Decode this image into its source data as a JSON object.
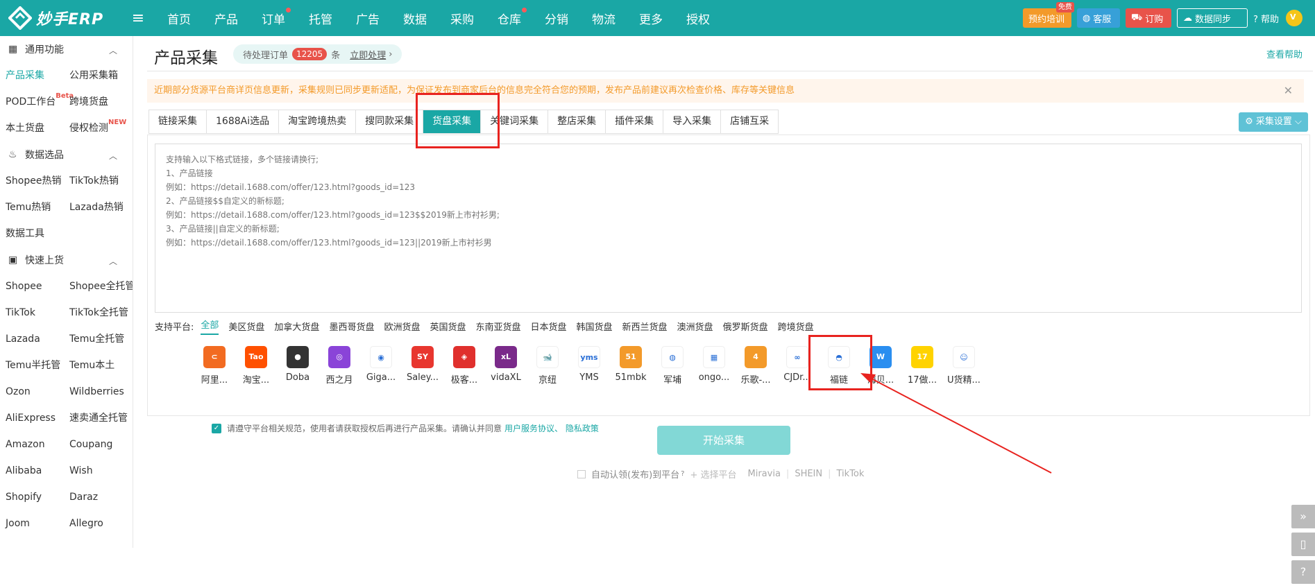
{
  "app": {
    "logo_text": "妙手ERP"
  },
  "nav": {
    "items": [
      {
        "label": "首页",
        "dot": false
      },
      {
        "label": "产品",
        "dot": false
      },
      {
        "label": "订单",
        "dot": true
      },
      {
        "label": "托管",
        "dot": false
      },
      {
        "label": "广告",
        "dot": false
      },
      {
        "label": "数据",
        "dot": false
      },
      {
        "label": "采购",
        "dot": false
      },
      {
        "label": "仓库",
        "dot": true
      },
      {
        "label": "分销",
        "dot": false
      },
      {
        "label": "物流",
        "dot": false
      },
      {
        "label": "更多",
        "dot": false
      },
      {
        "label": "授权",
        "dot": false
      }
    ]
  },
  "topbar": {
    "training": "预约培训",
    "training_badge": "免费",
    "service": "客服",
    "subscribe": "订购",
    "sync": "数据同步",
    "help": "帮助",
    "avatar_letter": "V"
  },
  "sidebar": {
    "sections": [
      {
        "title": "通用功能",
        "items": [
          {
            "label": "产品采集",
            "active": true
          },
          {
            "label": "公用采集箱"
          },
          {
            "label": "POD工作台",
            "sup": "Beta"
          },
          {
            "label": "跨境货盘"
          },
          {
            "label": "本土货盘"
          },
          {
            "label": "侵权检测",
            "sup": "NEW"
          }
        ]
      },
      {
        "title": "数据选品",
        "items": [
          {
            "label": "Shopee热销"
          },
          {
            "label": "TikTok热销"
          },
          {
            "label": "Temu热销"
          },
          {
            "label": "Lazada热销"
          },
          {
            "label": "数据工具"
          }
        ]
      },
      {
        "title": "快速上货",
        "items": [
          {
            "label": "Shopee"
          },
          {
            "label": "Shopee全托管"
          },
          {
            "label": "TikTok"
          },
          {
            "label": "TikTok全托管"
          },
          {
            "label": "Lazada"
          },
          {
            "label": "Temu全托管"
          },
          {
            "label": "Temu半托管"
          },
          {
            "label": "Temu本土"
          },
          {
            "label": "Ozon"
          },
          {
            "label": "Wildberries"
          },
          {
            "label": "AliExpress"
          },
          {
            "label": "速卖通全托管"
          },
          {
            "label": "Amazon"
          },
          {
            "label": "Coupang"
          },
          {
            "label": "Alibaba"
          },
          {
            "label": "Wish"
          },
          {
            "label": "Shopify"
          },
          {
            "label": "Daraz"
          },
          {
            "label": "Joom"
          },
          {
            "label": "Allegro"
          }
        ]
      }
    ]
  },
  "main": {
    "title": "产品采集",
    "pending": {
      "label": "待处理订单",
      "count": "12205",
      "unit": "条",
      "link": "立即处理"
    },
    "view_help": "查看帮助",
    "notice": "近期部分货源平台商详页信息更新，采集规则已同步更新适配，为保证发布到商家后台的信息完全符合您的预期，发布产品前建议再次检查价格、库存等关键信息",
    "tabs": [
      "链接采集",
      "1688Ai选品",
      "淘宝跨境热卖",
      "搜同款采集",
      "货盘采集",
      "关键词采集",
      "整店采集",
      "插件采集",
      "导入采集",
      "店铺互采"
    ],
    "active_tab": 4,
    "settings_btn": "采集设置",
    "placeholder": "支持输入以下格式链接，多个链接请换行;\n1、产品链接\n例如：https://detail.1688.com/offer/123.html?goods_id=123\n2、产品链接$$自定义的新标题;\n例如：https://detail.1688.com/offer/123.html?goods_id=123$$2019新上市衬衫男;\n3、产品链接||自定义的新标题;\n例如：https://detail.1688.com/offer/123.html?goods_id=123||2019新上市衬衫男",
    "platform_label": "支持平台:",
    "regions": [
      "全部",
      "美区货盘",
      "加拿大货盘",
      "墨西哥货盘",
      "欧洲货盘",
      "英国货盘",
      "东南亚货盘",
      "日本货盘",
      "韩国货盘",
      "新西兰货盘",
      "澳洲货盘",
      "俄罗斯货盘",
      "跨境货盘"
    ],
    "platforms": [
      {
        "name": "阿里...",
        "logo": "ali",
        "color": "#f26b21",
        "text": "⊂"
      },
      {
        "name": "淘宝...",
        "logo": "tao",
        "color": "#ff5000",
        "text": "Tao"
      },
      {
        "name": "Doba",
        "logo": "doba",
        "color": "#333333",
        "text": "●"
      },
      {
        "name": "西之月",
        "logo": "xzy",
        "color": "#8a44d8",
        "text": "◎"
      },
      {
        "name": "Giga...",
        "logo": "giga",
        "color": "#ffffff",
        "text": "◉"
      },
      {
        "name": "Saley...",
        "logo": "saley",
        "color": "#e8362f",
        "text": "SY"
      },
      {
        "name": "极客...",
        "logo": "jike",
        "color": "#e0302d",
        "text": "◈"
      },
      {
        "name": "vidaXL",
        "logo": "vida",
        "color": "#7a2a8a",
        "text": "xL"
      },
      {
        "name": "京纽",
        "logo": "jn",
        "color": "#ffffff",
        "text": "🐋"
      },
      {
        "name": "YMS",
        "logo": "yms",
        "color": "#ffffff",
        "text": "yms"
      },
      {
        "name": "51mbk",
        "logo": "51",
        "color": "#f39a2a",
        "text": "51"
      },
      {
        "name": "军埔",
        "logo": "jp",
        "color": "#ffffff",
        "text": "◍"
      },
      {
        "name": "ongo...",
        "logo": "ongo",
        "color": "#ffffff",
        "text": "▦"
      },
      {
        "name": "乐歌-...",
        "logo": "lg",
        "color": "#f39a2a",
        "text": "4"
      },
      {
        "name": "CJDr...",
        "logo": "cj",
        "color": "#ffffff",
        "text": "∞"
      },
      {
        "name": "福链",
        "logo": "fl",
        "color": "#ffffff",
        "text": "◓"
      },
      {
        "name": "海贝...",
        "logo": "hb",
        "color": "#2a8ef0",
        "text": "W"
      },
      {
        "name": "17做...",
        "logo": "17",
        "color": "#ffd300",
        "text": "17"
      },
      {
        "name": "U货精...",
        "logo": "u",
        "color": "#ffffff",
        "text": "☺"
      }
    ],
    "agree_text": "请遵守平台相关规范，使用者请获取授权后再进行产品采集。请确认并同意",
    "agree_link": "用户服务协议、 隐私政策",
    "start_btn": "开始采集",
    "auto_label": "自动认领(发布)到平台",
    "auto_select": "+ 选择平台",
    "auto_platforms": [
      "Miravia",
      "SHEIN",
      "TikTok"
    ]
  },
  "colors": {
    "accent": "#1aa7a5",
    "annotation": "#e8231f"
  }
}
